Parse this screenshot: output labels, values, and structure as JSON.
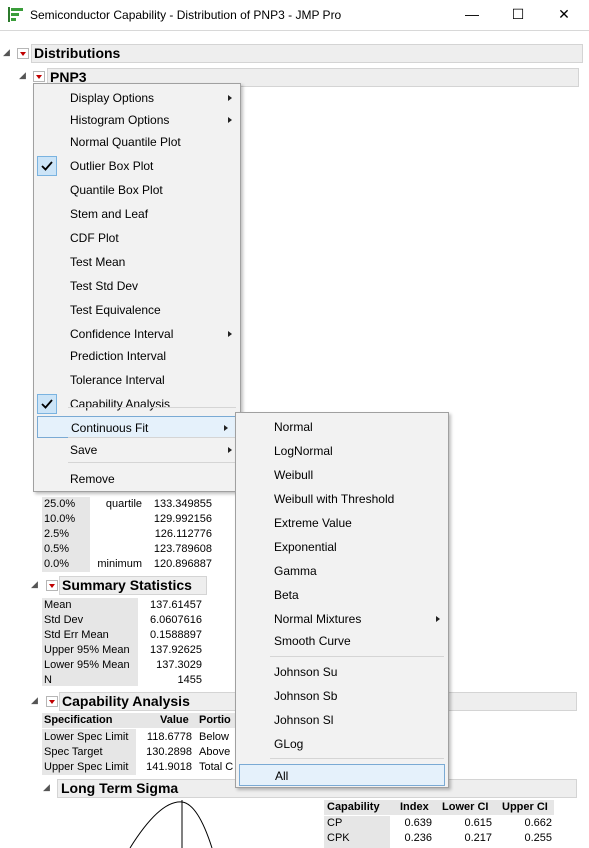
{
  "window": {
    "title": "Semiconductor Capability - Distribution of PNP3 - JMP Pro",
    "minimize_glyph": "—",
    "maximize_glyph": "☐",
    "close_glyph": "✕"
  },
  "report": {
    "distributions_title": "Distributions",
    "variable_title": "PNP3",
    "quantiles": [
      {
        "pct": "25.0%",
        "label": "quartile",
        "value": "133.349855"
      },
      {
        "pct": "10.0%",
        "label": "",
        "value": "129.992156"
      },
      {
        "pct": "2.5%",
        "label": "",
        "value": "126.112776"
      },
      {
        "pct": "0.5%",
        "label": "",
        "value": "123.789608"
      },
      {
        "pct": "0.0%",
        "label": "minimum",
        "value": "120.896887"
      }
    ],
    "summary_title": "Summary Statistics",
    "summary": [
      {
        "label": "Mean",
        "value": "137.61457"
      },
      {
        "label": "Std Dev",
        "value": "6.0607616"
      },
      {
        "label": "Std Err Mean",
        "value": "0.1588897"
      },
      {
        "label": "Upper 95% Mean",
        "value": "137.92625"
      },
      {
        "label": "Lower 95% Mean",
        "value": "137.3029"
      },
      {
        "label": "N",
        "value": "1455"
      }
    ],
    "capability_title": "Capability Analysis",
    "spec_headers": {
      "specification": "Specification",
      "value": "Value",
      "portion": "Portio"
    },
    "specs": [
      {
        "label": "Lower Spec Limit",
        "value": "118.6778",
        "portion": "Below"
      },
      {
        "label": "Spec Target",
        "value": "130.2898",
        "portion": "Above"
      },
      {
        "label": "Upper Spec Limit",
        "value": "141.9018",
        "portion": "Total C"
      }
    ],
    "long_term_title": "Long Term Sigma",
    "cap_headers": {
      "capability": "Capability",
      "index": "Index",
      "lower_ci": "Lower CI",
      "upper_ci": "Upper CI"
    },
    "cap_rows": [
      {
        "capability": "CP",
        "index": "0.639",
        "lower_ci": "0.615",
        "upper_ci": "0.662"
      },
      {
        "capability": "CPK",
        "index": "0.236",
        "lower_ci": "0.217",
        "upper_ci": "0.255"
      }
    ]
  },
  "context_menu": {
    "items": [
      {
        "label": "Display Options",
        "submenu": true,
        "checked": false
      },
      {
        "label": "Histogram Options",
        "submenu": true,
        "checked": false
      },
      {
        "label": "Normal Quantile Plot",
        "submenu": false,
        "checked": false
      },
      {
        "label": "Outlier Box Plot",
        "submenu": false,
        "checked": true
      },
      {
        "label": "Quantile Box Plot",
        "submenu": false,
        "checked": false
      },
      {
        "label": "Stem and Leaf",
        "submenu": false,
        "checked": false
      },
      {
        "label": "CDF Plot",
        "submenu": false,
        "checked": false
      },
      {
        "label": "Test Mean",
        "submenu": false,
        "checked": false
      },
      {
        "label": "Test Std Dev",
        "submenu": false,
        "checked": false
      },
      {
        "label": "Test Equivalence",
        "submenu": false,
        "checked": false
      },
      {
        "label": "Confidence Interval",
        "submenu": true,
        "checked": false
      },
      {
        "label": "Prediction Interval",
        "submenu": false,
        "checked": false
      },
      {
        "label": "Tolerance Interval",
        "submenu": false,
        "checked": false
      },
      {
        "label": "Capability Analysis",
        "submenu": false,
        "checked": true
      },
      {
        "label": "Continuous Fit",
        "submenu": true,
        "checked": false,
        "highlighted": true
      },
      {
        "label": "Save",
        "submenu": true,
        "checked": false
      },
      {
        "label": "Remove",
        "submenu": false,
        "checked": false
      }
    ]
  },
  "fit_submenu": {
    "items": [
      {
        "label": "Normal",
        "submenu": false
      },
      {
        "label": "LogNormal",
        "submenu": false
      },
      {
        "label": "Weibull",
        "submenu": false
      },
      {
        "label": "Weibull with Threshold",
        "submenu": false
      },
      {
        "label": "Extreme Value",
        "submenu": false
      },
      {
        "label": "Exponential",
        "submenu": false
      },
      {
        "label": "Gamma",
        "submenu": false
      },
      {
        "label": "Beta",
        "submenu": false
      },
      {
        "label": "Normal Mixtures",
        "submenu": true
      },
      {
        "label": "Smooth Curve",
        "submenu": false
      },
      {
        "label": "Johnson Su",
        "submenu": false
      },
      {
        "label": "Johnson Sb",
        "submenu": false
      },
      {
        "label": "Johnson Sl",
        "submenu": false
      },
      {
        "label": "GLog",
        "submenu": false
      },
      {
        "label": "All",
        "submenu": false,
        "highlighted": true
      }
    ]
  },
  "colors": {
    "red_triangle": "#c00000",
    "highlight_fill": "#e5f1fb",
    "highlight_border": "#7aaad4",
    "check_fill": "#cce4f7"
  }
}
